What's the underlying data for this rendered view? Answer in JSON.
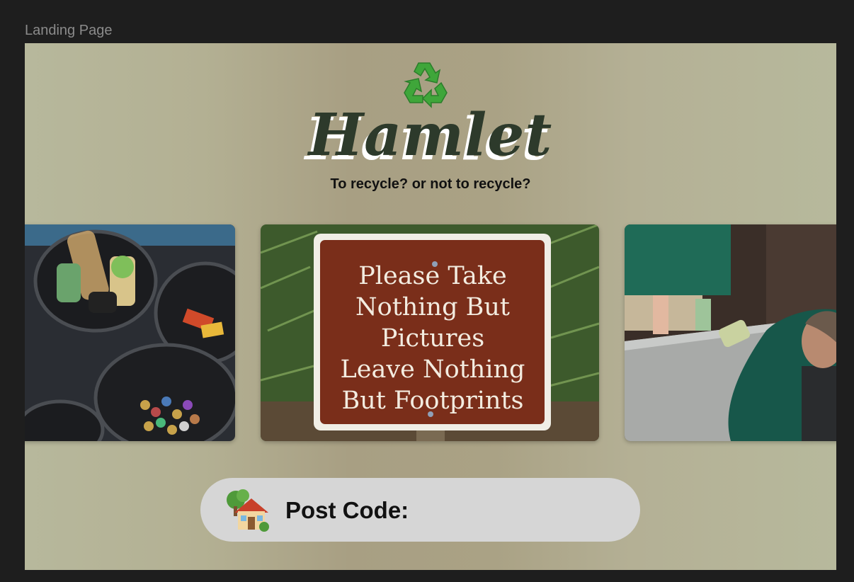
{
  "frame": {
    "label": "Landing Page"
  },
  "header": {
    "logo_icon": "recycle-icon",
    "brand": "Hamlet",
    "tagline": "To recycle? or not to recycle?"
  },
  "gallery": {
    "cards": [
      {
        "icon": "recycling-buckets-photo"
      },
      {
        "icon": "park-sign-photo",
        "sign_lines": [
          "Please Take",
          "Nothing But",
          "Pictures",
          "Leave Nothing",
          "But Footprints"
        ]
      },
      {
        "icon": "volunteers-lifting-bin-photo"
      }
    ]
  },
  "postcode": {
    "icon": "house-with-tree-icon",
    "label": "Post Code:",
    "value": "",
    "placeholder": ""
  },
  "colors": {
    "canvas_bg": "#1e1e1e",
    "frame_bg": "#b7b89c",
    "brand_text": "#2d3a2b",
    "pill_bg": "#d6d6d6",
    "recycle_green": "#3fa63a"
  }
}
